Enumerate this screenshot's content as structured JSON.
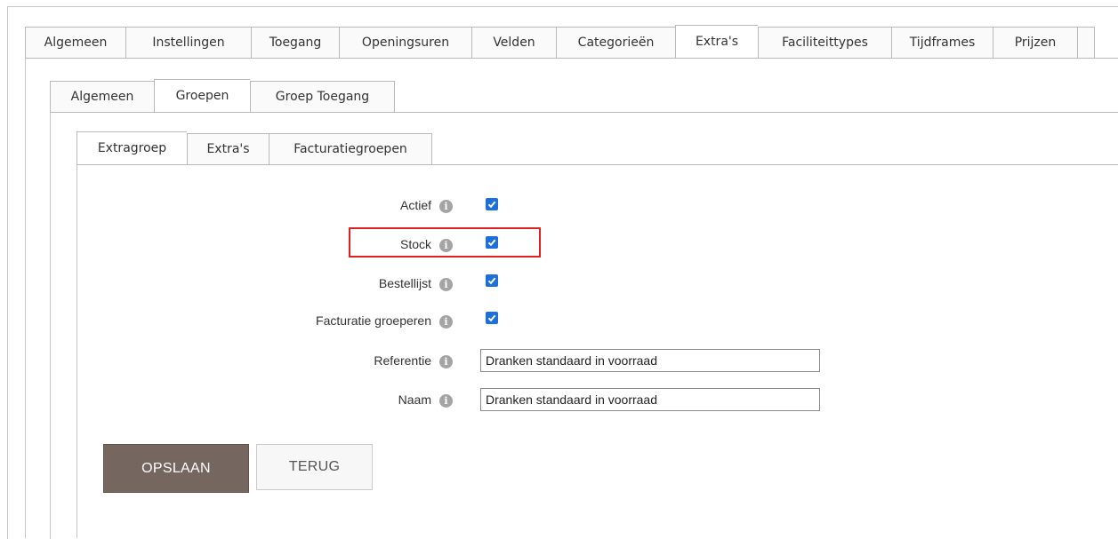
{
  "main_tabs": [
    {
      "label": "Algemeen"
    },
    {
      "label": "Instellingen"
    },
    {
      "label": "Toegang"
    },
    {
      "label": "Openingsuren"
    },
    {
      "label": "Velden"
    },
    {
      "label": "Categorieën"
    },
    {
      "label": "Extra's",
      "active": true
    },
    {
      "label": "Faciliteittypes"
    },
    {
      "label": "Tijdframes"
    },
    {
      "label": "Prijzen"
    }
  ],
  "sub_tabs": [
    {
      "label": "Algemeen"
    },
    {
      "label": "Groepen",
      "active": true
    },
    {
      "label": "Groep Toegang"
    }
  ],
  "inner_tabs": [
    {
      "label": "Extragroep",
      "active": true
    },
    {
      "label": "Extra's"
    },
    {
      "label": "Facturatiegroepen"
    }
  ],
  "form": {
    "actief_label": "Actief",
    "actief_checked": true,
    "stock_label": "Stock",
    "stock_checked": true,
    "bestellijst_label": "Bestellijst",
    "bestellijst_checked": true,
    "facturatie_label": "Facturatie groeperen",
    "facturatie_checked": true,
    "referentie_label": "Referentie",
    "referentie_value": "Dranken standaard in voorraad",
    "naam_label": "Naam",
    "naam_value": "Dranken standaard in voorraad",
    "info_glyph": "i"
  },
  "buttons": {
    "save_label": "OPSLAAN",
    "back_label": "TERUG"
  },
  "colors": {
    "checkbox": "#1e6fd9",
    "highlight": "#e02020",
    "save_button": "#75675f"
  }
}
